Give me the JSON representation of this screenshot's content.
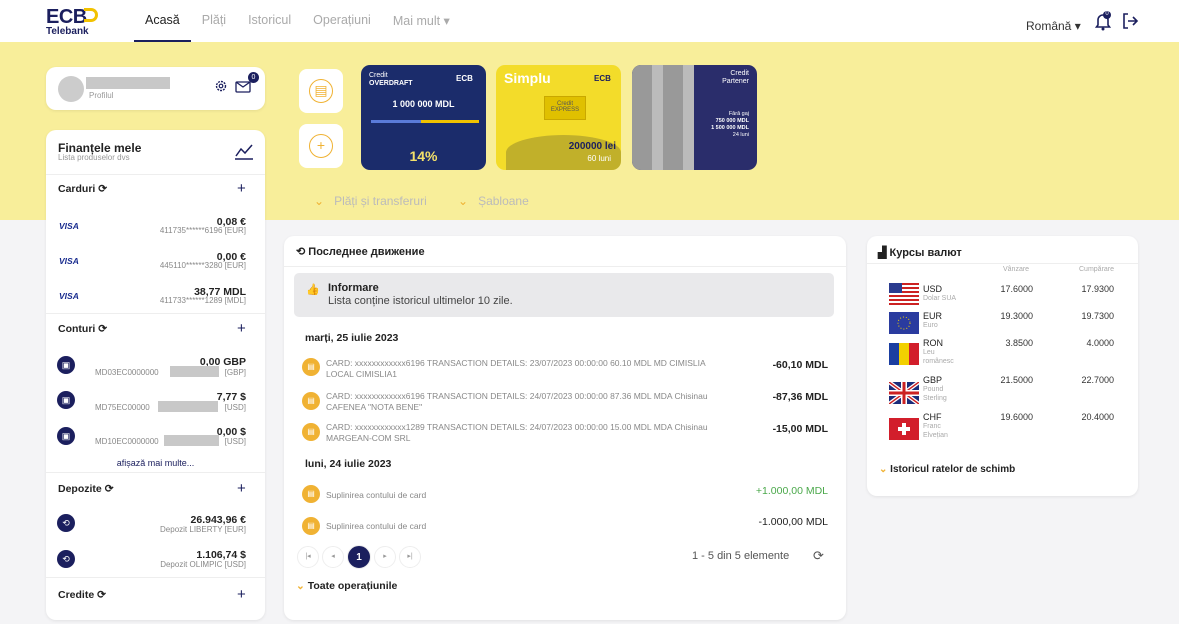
{
  "brand": {
    "name": "ECB",
    "sub": "Telebank"
  },
  "nav": {
    "items": [
      "Acasă",
      "Plăți",
      "Istoricul",
      "Operațiuni",
      "Mai mult ▾"
    ],
    "lang": "Română ▾",
    "bell_badge": "0"
  },
  "profile": {
    "label": "Profilul",
    "mail_badge": "0"
  },
  "finance": {
    "title": "Finanțele mele",
    "subtitle": "Lista produselor dvs",
    "cards_title": "Carduri",
    "cards": [
      {
        "brand": "VISA",
        "amount": "0,08 €",
        "account": "411735******6196 [EUR]"
      },
      {
        "brand": "VISA",
        "amount": "0,00 €",
        "account": "445110******3280 [EUR]"
      },
      {
        "brand": "VISA",
        "amount": "38,77 MDL",
        "account": "411733******1289 [MDL]"
      }
    ],
    "accounts_title": "Conturi",
    "accounts": [
      {
        "amount": "0,00 GBP",
        "account": "MD03EC0000000",
        "currency": "[GBP]"
      },
      {
        "amount": "7,77 $",
        "account": "MD75EC00000",
        "currency": "[USD]"
      },
      {
        "amount": "0,00 $",
        "account": "MD10EC0000000",
        "currency": "[USD]"
      }
    ],
    "show_more": "afișază mai multe...",
    "deposits_title": "Depozite",
    "deposits": [
      {
        "amount": "26.943,96 €",
        "account": "Depozit LIBERTY [EUR]"
      },
      {
        "amount": "1.106,74 $",
        "account": "Depozit OLIMPIC [USD]"
      }
    ],
    "credits_title": "Credite"
  },
  "promos": [
    {
      "tag": "Credit",
      "title": "OVERDRAFT",
      "brand": "ECB",
      "amount": "1 000 000 MDL",
      "rate": "14%"
    },
    {
      "title": "Simplu",
      "brand": "ECB",
      "label": "Credit EXPRESS",
      "amount": "200000 lei",
      "term": "60 luni"
    },
    {
      "tag": "Credit",
      "title": "Partener",
      "note1": "Fără gaj",
      "note2": "750 000 MDL",
      "note3": "1 500 000 MDL",
      "note4": "24 luni"
    }
  ],
  "payments": {
    "link1": "Plăți și transferuri",
    "link2": "Șabloane"
  },
  "movements": {
    "title": "Последнее движение",
    "info_title": "Informare",
    "info_text": "Lista conține istoricul ultimelor 10 zile.",
    "day1": "marți, 25 iulie 2023",
    "day2": "luni, 24 iulie 2023",
    "tx": [
      {
        "text": "CARD: xxxxxxxxxxxx6196 TRANSACTION DETAILS: 23/07/2023 00:00:00 60.10 MDL MD CIMISLIA LOCAL CIMISLIA1",
        "amount": "-60,10 MDL"
      },
      {
        "text": "CARD: xxxxxxxxxxxx6196 TRANSACTION DETAILS: 24/07/2023 00:00:00 87.36 MDL MDA Chisinau CAFENEA \"NOTA BENE\"",
        "amount": "-87,36 MDL"
      },
      {
        "text": "CARD: xxxxxxxxxxxx1289 TRANSACTION DETAILS: 24/07/2023 00:00:00 15.00 MDL MDA Chisinau MARGEAN-COM SRL",
        "amount": "-15,00 MDL"
      },
      {
        "text": "Suplinirea contului de card",
        "amount": "+1.000,00 MDL"
      },
      {
        "text": "Suplinirea contului de card",
        "amount": "-1.000,00 MDL"
      }
    ],
    "page": "1",
    "range": "1 - 5 din 5 elemente",
    "all_ops": "Toate operațiunile"
  },
  "rates": {
    "title": "Курсы валют",
    "col_sell": "Vânzare",
    "col_buy": "Cumpărare",
    "rows": [
      {
        "code": "USD",
        "name": "Dolar SUA",
        "sell": "17.6000",
        "buy": "17.9300"
      },
      {
        "code": "EUR",
        "name": "Euro",
        "sell": "19.3000",
        "buy": "19.7300"
      },
      {
        "code": "RON",
        "name": "Leu românesc",
        "sell": "3.8500",
        "buy": "4.0000"
      },
      {
        "code": "GBP",
        "name": "Pound Sterling",
        "sell": "21.5000",
        "buy": "22.7000"
      },
      {
        "code": "CHF",
        "name": "Franc Elvețian",
        "sell": "19.6000",
        "buy": "20.4000"
      }
    ],
    "history": "Istoricul ratelor de schimb"
  },
  "colors": {
    "navy": "#1b1f5e",
    "yellow": "#f8ee9a",
    "accent": "#f0b233",
    "green": "#4aa84a"
  }
}
